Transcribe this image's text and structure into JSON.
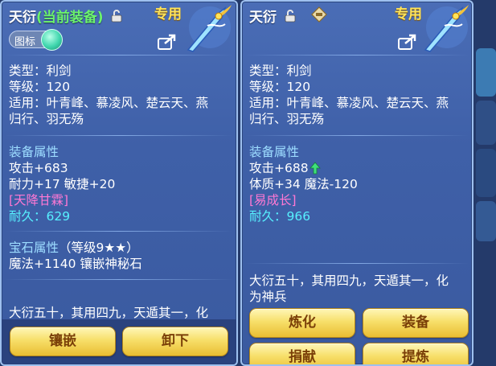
{
  "left": {
    "title_name": "天衍",
    "title_status": "(当前装备)",
    "special_label": "专用",
    "icon_toggle_label": "图标",
    "type": "类型：利剑",
    "level": "等级：120",
    "suitable_1": "适用：叶青峰、慕凌风、楚云天、燕",
    "suitable_2": "归行、羽无殇",
    "attr_header": "装备属性",
    "attack": "攻击+683",
    "stats": "耐力+17 敏捷+20",
    "effect": "[天降甘霖]",
    "durability_label": "耐久：",
    "durability_value": "629",
    "gem_header": "宝石属性",
    "gem_level": "（等级9★★）",
    "gem_desc": "魔法+1140 镶嵌神秘石",
    "desc": "大衍五十，其用四九，天遁其一，化",
    "buttons": {
      "inlay": "镶嵌",
      "unequip": "卸下"
    }
  },
  "right": {
    "title_name": "天衍",
    "special_label": "专用",
    "type": "类型：利剑",
    "level": "等级：120",
    "suitable_1": "适用：叶青峰、慕凌风、楚云天、燕",
    "suitable_2": "归行、羽无殇",
    "attr_header": "装备属性",
    "attack": "攻击+688",
    "stats": "体质+34 魔法-120",
    "effect": "[易成长]",
    "durability_label": "耐久：",
    "durability_value": "966",
    "desc_1": "大衍五十，其用四九，天遁其一，化",
    "desc_2": "为神兵",
    "buttons": {
      "refine": "炼化",
      "equip": "装备",
      "donate": "捐献",
      "extract": "提炼"
    }
  },
  "colors": {
    "panel": "#4a6db6",
    "equipped_status": "#6cf36c",
    "section_header": "#9ddcff",
    "effect": "#ff78d4",
    "durability": "#57f0ff",
    "special": "#ffe45a",
    "button": "#f7df6a"
  }
}
